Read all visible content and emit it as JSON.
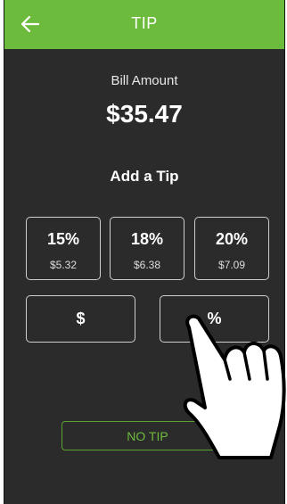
{
  "appbar": {
    "title": "TIP",
    "back_icon": "arrow-left-icon",
    "color": "#6dbb3c"
  },
  "bill": {
    "label": "Bill Amount",
    "amount": "$35.47"
  },
  "tip": {
    "heading": "Add a Tip",
    "options": [
      {
        "percent": "15%",
        "amount": "$5.32"
      },
      {
        "percent": "18%",
        "amount": "$6.38"
      },
      {
        "percent": "20%",
        "amount": "$7.09"
      }
    ],
    "custom_dollar_label": "$",
    "custom_percent_label": "%",
    "no_tip_label": "NO TIP"
  },
  "overlay": {
    "icon": "pointing-hand-icon"
  },
  "colors": {
    "background": "#2b2b2b",
    "accent": "#6dbb3c",
    "text": "#ffffff"
  }
}
